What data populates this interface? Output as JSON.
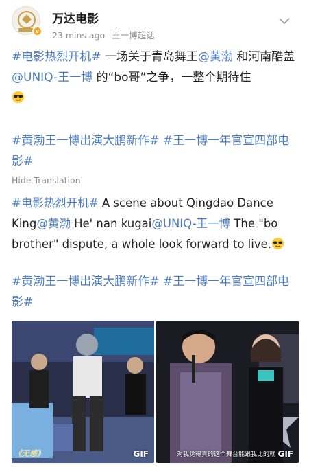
{
  "post": {
    "author": "万达电影",
    "time": "23 mins ago",
    "source": "王一博超话",
    "avatar_text": "万达电影",
    "colors": {
      "link": "#4c7cc0",
      "meta": "#8c8c8c",
      "verified": "#f5a623"
    }
  },
  "original": {
    "topic1": "#电影热烈开机#",
    "t1": " 一场关于青岛舞王",
    "mention1": "@黄渤",
    "t2": " 和河南酷盖",
    "mention2": "@UNIQ-王一博",
    "t3": " 的“bo哥”之争，一整个期待住"
  },
  "original_tags": {
    "topic2": "#黄渤王一博出演大鹏新作#",
    "topic3": "#王一博一年官宣四部电影#"
  },
  "hide_translation": "Hide Translation",
  "translation": {
    "topic1": "#电影热烈开机#",
    "t1": " A scene about Qingdao Dance King",
    "mention1": "@黄渤",
    "t2": " He' nan kugai",
    "mention2": "@UNIQ-王一博",
    "t3": " The \"bo brother\" dispute, a whole look forward to live."
  },
  "translation_tags": {
    "topic2": "#黄渤王一博出演大鹏新作#",
    "topic3": "#王一博一年官宣四部电影#"
  },
  "media": [
    {
      "badge": "GIF",
      "caption": "《无感》"
    },
    {
      "badge": "GIF",
      "subtitle": "对我觉得真的这个舞台能跟我比的就"
    }
  ]
}
